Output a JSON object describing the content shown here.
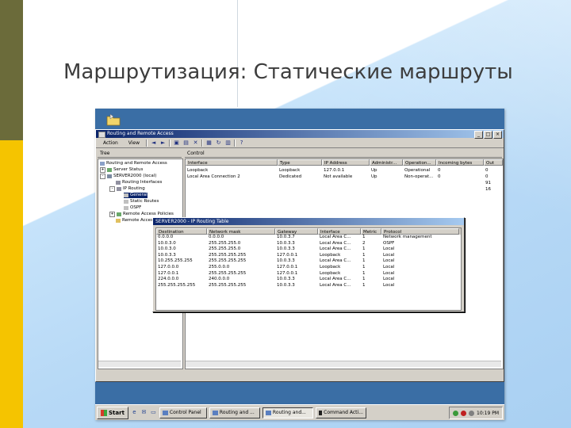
{
  "slide": {
    "title": "Маршрутизация: Статические маршруты"
  },
  "window": {
    "title": "Routing and Remote Access",
    "controls": [
      "_",
      "□",
      "×"
    ],
    "toolbar": {
      "action": "Action",
      "view": "View"
    },
    "tree_header": "Tree",
    "list_header": "Control",
    "tree": [
      {
        "label": "Routing and Remote Access",
        "indent": 0,
        "expander": ""
      },
      {
        "label": "Server Status",
        "indent": 1,
        "expander": "+"
      },
      {
        "label": "SERVER2000 (local)",
        "indent": 1,
        "expander": "-"
      },
      {
        "label": "Routing Interfaces",
        "indent": 2,
        "expander": ""
      },
      {
        "label": "IP Routing",
        "indent": 2,
        "expander": "-"
      },
      {
        "label": "General",
        "indent": 3,
        "expander": ""
      },
      {
        "label": "Static Routes",
        "indent": 3,
        "expander": ""
      },
      {
        "label": "OSPF",
        "indent": 3,
        "expander": ""
      },
      {
        "label": "Remote Access Policies",
        "indent": 2,
        "expander": "+"
      },
      {
        "label": "Remote Access Logging",
        "indent": 2,
        "expander": ""
      }
    ],
    "list_columns": [
      "Interface",
      "Type",
      "IP Address",
      "Administr...",
      "Operation...",
      "Incoming bytes",
      "Out"
    ],
    "list_rows": [
      [
        "Loopback",
        "Loopback",
        "127.0.0.1",
        "Up",
        "Operational",
        "0",
        "0"
      ],
      [
        "Local Area Connection 2",
        "Dedicated",
        "Not available",
        "Up",
        "Non-operat...",
        "0",
        "0"
      ],
      [
        "",
        "",
        "",
        "",
        "",
        "",
        "91"
      ],
      [
        "",
        "",
        "",
        "",
        "",
        "",
        "16"
      ]
    ]
  },
  "routing_dialog": {
    "title": "SERVER2000 - IP Routing Table",
    "columns": [
      "Destination",
      "Network mask",
      "Gateway",
      "Interface",
      "Metric",
      "Protocol"
    ],
    "rows": [
      [
        "0.0.0.0",
        "0.0.0.0",
        "10.0.3.7",
        "Local Area C...",
        "1",
        "Network management"
      ],
      [
        "10.0.3.0",
        "255.255.255.0",
        "10.0.3.3",
        "Local Area C...",
        "2",
        "OSPF"
      ],
      [
        "10.0.3.0",
        "255.255.255.0",
        "10.0.3.3",
        "Local Area C...",
        "1",
        "Local"
      ],
      [
        "10.0.3.3",
        "255.255.255.255",
        "127.0.0.1",
        "Loopback",
        "1",
        "Local"
      ],
      [
        "10.255.255.255",
        "255.255.255.255",
        "10.0.3.3",
        "Local Area C...",
        "1",
        "Local"
      ],
      [
        "127.0.0.0",
        "255.0.0.0",
        "127.0.0.1",
        "Loopback",
        "1",
        "Local"
      ],
      [
        "127.0.0.1",
        "255.255.255.255",
        "127.0.0.1",
        "Loopback",
        "1",
        "Local"
      ],
      [
        "224.0.0.0",
        "240.0.0.0",
        "10.0.3.3",
        "Local Area C...",
        "1",
        "Local"
      ],
      [
        "255.255.255.255",
        "255.255.255.255",
        "10.0.3.3",
        "Local Area C...",
        "1",
        "Local"
      ]
    ]
  },
  "taskbar": {
    "start": "Start",
    "tasks": [
      "Control Panel",
      "Routing and ...",
      "Routing and...",
      "Command Acti..."
    ],
    "active_index": 2,
    "clock": "10:19 PM"
  },
  "colors": {
    "olive_bar": "#6b6b3a",
    "yellow_bar": "#f5c400",
    "desktop": "#3a6ea5",
    "titlebar": "#0a246a"
  }
}
